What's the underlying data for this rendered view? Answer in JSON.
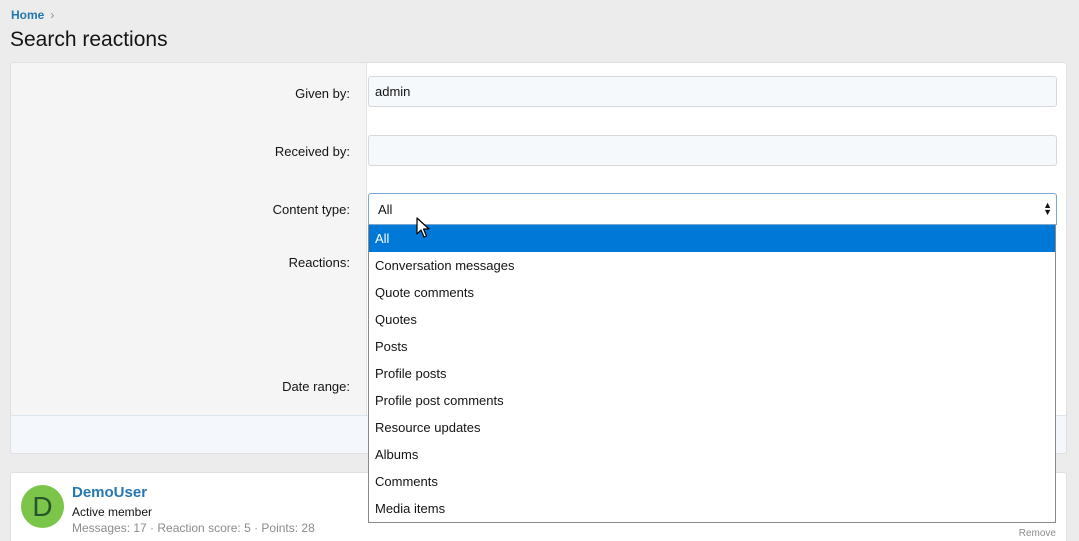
{
  "breadcrumb": {
    "home": "Home",
    "separator": "›"
  },
  "page": {
    "title": "Search reactions"
  },
  "form": {
    "given_by": {
      "label": "Given by:",
      "value": "admin"
    },
    "received_by": {
      "label": "Received by:",
      "value": ""
    },
    "content_type": {
      "label": "Content type:",
      "selected": "All"
    },
    "reactions": {
      "label": "Reactions:"
    },
    "date_range": {
      "label": "Date range:"
    }
  },
  "dropdown": {
    "options": [
      "All",
      "Conversation messages",
      "Quote comments",
      "Quotes",
      "Posts",
      "Profile posts",
      "Profile post comments",
      "Resource updates",
      "Albums",
      "Comments",
      "Media items"
    ]
  },
  "result": {
    "avatar_letter": "D",
    "user_name": "DemoUser",
    "user_title": "Active member",
    "stats": "Messages: 17 · Reaction score: 5 · Points: 28",
    "remove": "Remove"
  },
  "colors": {
    "link": "#2577b1",
    "selected_option": "#0078d7",
    "avatar_bg": "#7bc54a"
  }
}
